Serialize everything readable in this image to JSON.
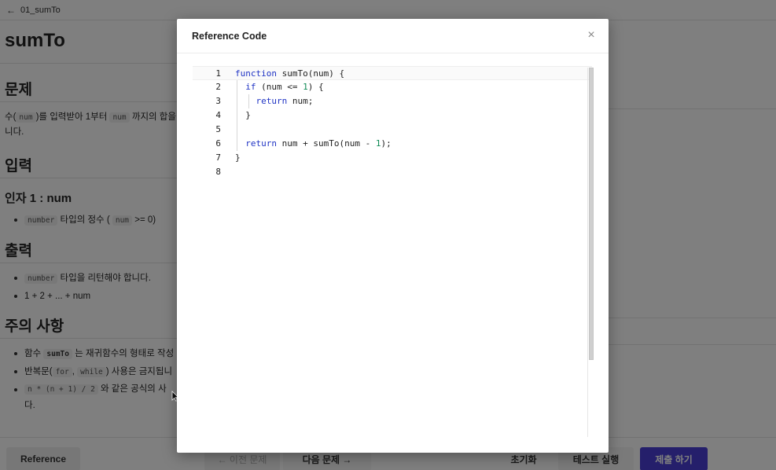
{
  "topbar": {
    "back_icon": "arrow-left-icon",
    "title": "01_sumTo"
  },
  "problem": {
    "title": "sumTo",
    "section_problem": "문제",
    "description_line1_a": "수(",
    "description_line1_code": "num",
    "description_line1_b": ")를 입력받아 1부터",
    "description_line1_code2": "num",
    "description_line1_c": "까지의 합을",
    "description_line2": "니다.",
    "section_input": "입력",
    "input_arg_title": "인자 1 : num",
    "input_bullet_code": "number",
    "input_bullet_text_a": "타입의 정수 (",
    "input_bullet_code2": "num",
    "input_bullet_text_b": ">= 0)",
    "section_output": "출력",
    "output_bullet1_code": "number",
    "output_bullet1_text": "타입을 리턴해야 합니다.",
    "output_bullet2_text": "1 + 2 + ... + num",
    "section_notes": "주의 사항",
    "note1_text_a": "함수",
    "note1_code": "sumTo",
    "note1_text_b": "는 재귀함수의 형태로 작성",
    "note2_text_a": "반복문(",
    "note2_code1": "for",
    "note2_sep": ",",
    "note2_code2": "while",
    "note2_text_b": ") 사용은 금지됩니",
    "note3_code": "n * (n + 1) / 2",
    "note3_text": "와 같은 공식의 사",
    "note3_line2": "다."
  },
  "bottom": {
    "reference_label": "Reference",
    "prev_label": "← 이전 문제",
    "next_label": "다음 문제 →",
    "reset_label": "초기화",
    "test_label": "테스트 실행",
    "submit_label": "제출 하기",
    "submit_color": "#4a3fd6"
  },
  "modal": {
    "title": "Reference Code",
    "close_icon": "close-icon",
    "code_lines": [
      {
        "num": "1",
        "text": "function sumTo(num) {"
      },
      {
        "num": "2",
        "text": "  if (num <= 1) {"
      },
      {
        "num": "3",
        "text": "    return num;"
      },
      {
        "num": "4",
        "text": "  }"
      },
      {
        "num": "5",
        "text": ""
      },
      {
        "num": "6",
        "text": "  return num + sumTo(num - 1);"
      },
      {
        "num": "7",
        "text": "}"
      },
      {
        "num": "8",
        "text": ""
      }
    ],
    "active_line": 1
  }
}
